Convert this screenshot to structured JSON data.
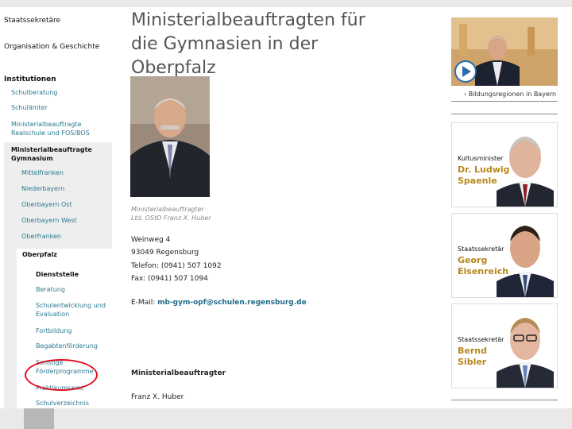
{
  "page": {
    "title": "Ministerialbeauftragten für die Gymnasien in der Oberpfalz"
  },
  "sidebar": {
    "top_items": [
      "Staatssekretäre",
      "Organisation & Geschichte"
    ],
    "section": "Institutionen",
    "institution_items": [
      "Schulberatung",
      "Schulämter",
      "Ministerialbeauftragte Realschule und FOS/BOS"
    ],
    "gymnasium": {
      "title": "Ministerialbeauftragte Gymnasium",
      "regions": [
        "Mittelfranken",
        "Niederbayern",
        "Oberbayern Ost",
        "Oberbayern West",
        "Oberfranken"
      ],
      "current_region": "Oberpfalz",
      "sub_items": [
        "Dienststelle",
        "Beratung",
        "Schulentwicklung und Evaluation",
        "Fortbildung",
        "Begabtenförderung",
        "Sonstige Förderprogramme",
        "Praktikumsamt",
        "Schulverzeichnis"
      ]
    }
  },
  "contact": {
    "caption_line1": "Ministerialbeauftragter",
    "caption_line2": "Ltd. OStD Franz X. Huber",
    "street": "Weinweg 4",
    "city": "93049 Regensburg",
    "phone": "Telefon: (0941) 507 1092",
    "fax": "Fax: (0941) 507 1094",
    "email_label": "E-Mail:",
    "email": "mb-gym-opf@schulen.regensburg.de",
    "subhead": "Ministerialbeauftragter",
    "name": "Franz X. Huber"
  },
  "right": {
    "video_icon": "play-icon",
    "link": "› Bildungsregionen in Bayern",
    "cards": [
      {
        "role": "Kultusminister",
        "name1": "Dr. Ludwig",
        "name2": "Spaenle"
      },
      {
        "role": "Staatssekretär",
        "name1": "Georg",
        "name2": "Eisenreich"
      },
      {
        "role": "Staatssekretär",
        "name1": "Bernd",
        "name2": "Sibler"
      }
    ]
  },
  "colors": {
    "link": "#2a7a8f",
    "name_gold": "#b7871a",
    "highlight_circle": "#e0101e"
  }
}
